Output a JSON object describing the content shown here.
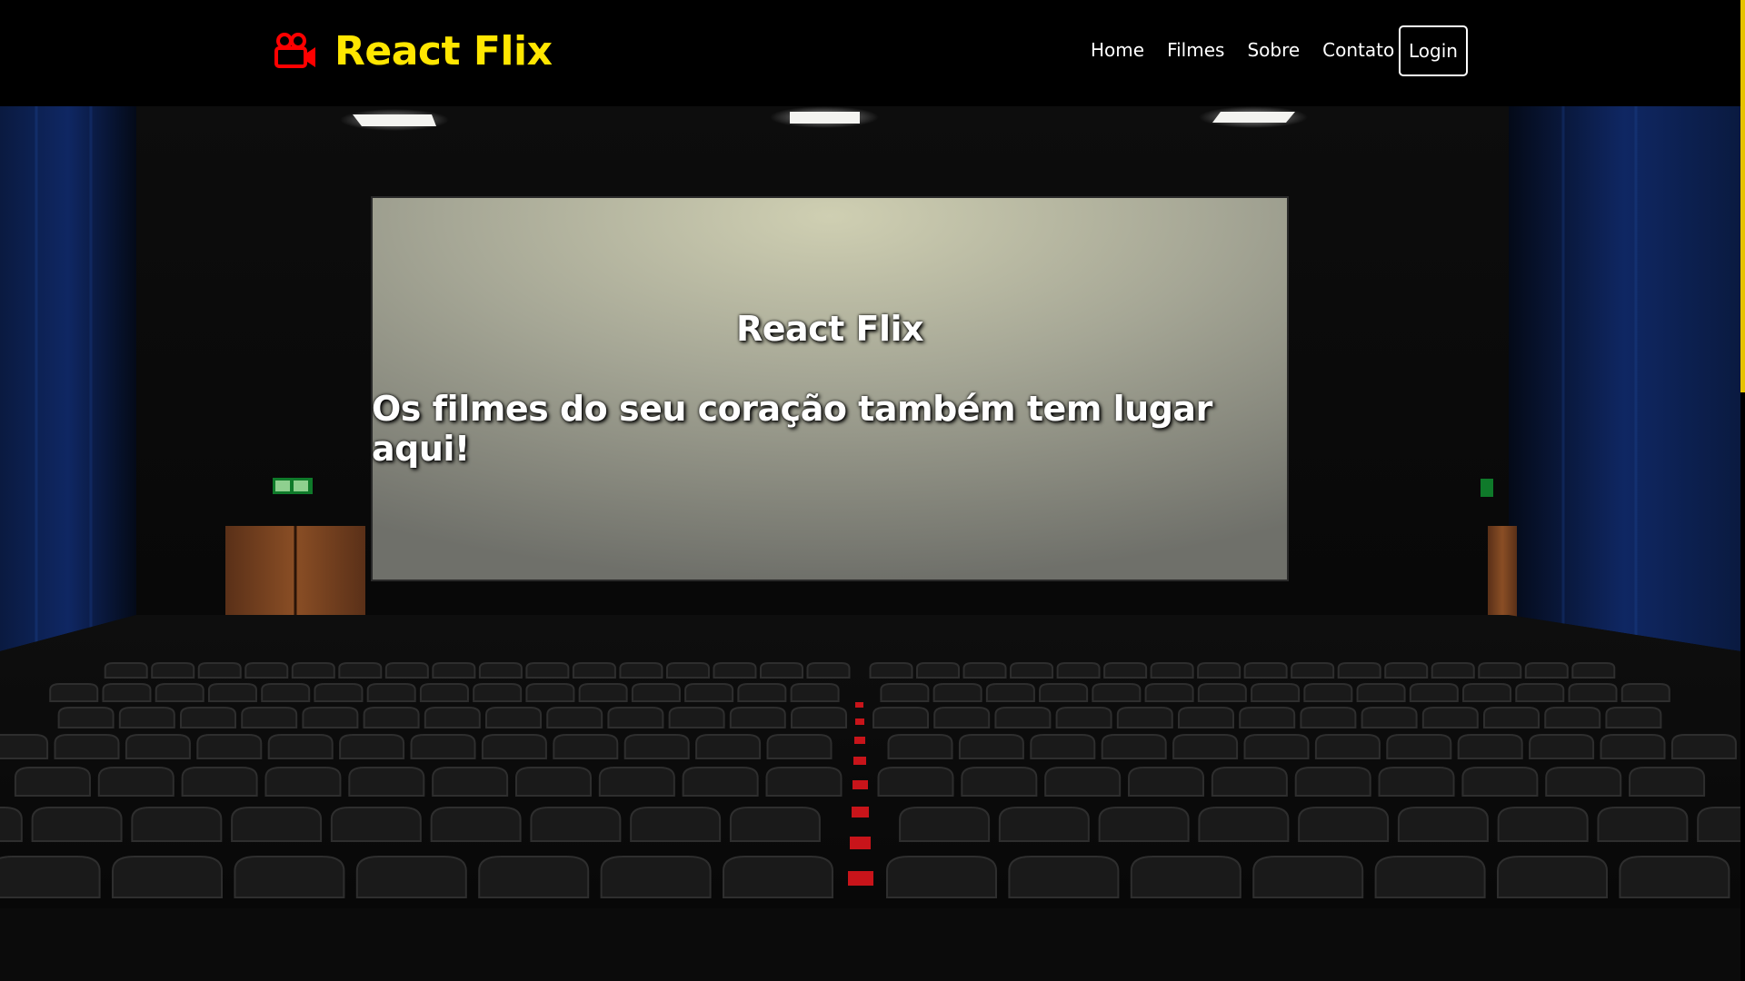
{
  "brand": {
    "name": "React Flix",
    "icon": "video-camera-icon",
    "icon_color": "#ff0000",
    "text_color": "#ffe600"
  },
  "nav": {
    "links": [
      {
        "label": "Home"
      },
      {
        "label": "Filmes"
      },
      {
        "label": "Sobre"
      },
      {
        "label": "Contato"
      }
    ],
    "login_label": "Login"
  },
  "hero": {
    "title": "React Flix",
    "subtitle": "Os filmes do seu coração também tem lugar aqui!",
    "background": "cinema-auditorium-image"
  },
  "scrollbar": {
    "thumb_color": "#e6c300",
    "scroll_fraction": 0.4
  }
}
